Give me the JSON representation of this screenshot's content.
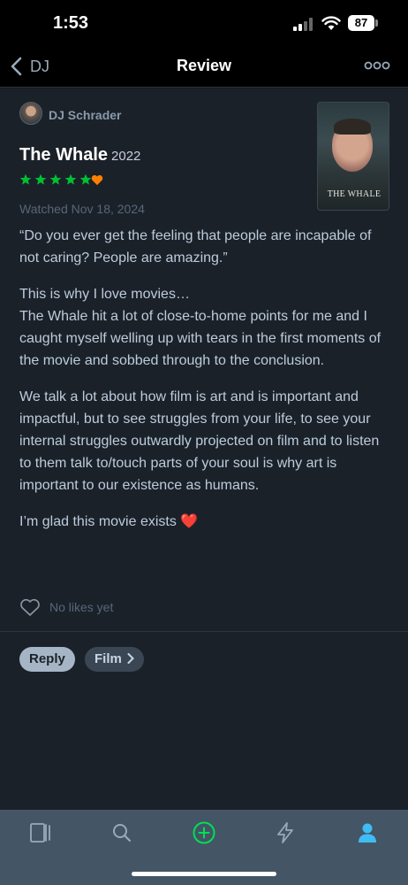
{
  "status_bar": {
    "time": "1:53",
    "battery": "87"
  },
  "nav": {
    "back_label": "DJ",
    "title": "Review"
  },
  "review": {
    "author": "DJ Schrader",
    "film_title": "The Whale",
    "film_year": "2022",
    "rating_stars": 5,
    "liked": true,
    "watched_text": "Watched Nov 18, 2024",
    "poster_text": "THE WHALE",
    "paragraphs": [
      "“Do you ever get the feeling that people are incapable of not caring? People are amazing.”",
      "This is why I love movies…\nThe Whale hit a lot of close-to-home points for me and I caught myself welling up with tears in the first moments of the movie and sobbed through to the conclusion.",
      "We talk a lot about how film is art and is important and impactful, but to see struggles from your life, to see your internal struggles outwardly projected on film and to listen to them talk to/touch parts of your soul is why art is important to our existence as humans.",
      "I’m glad this movie exists ❤️"
    ],
    "likes_text": "No likes yet"
  },
  "actions": {
    "reply_label": "Reply",
    "film_label": "Film"
  },
  "tabs": [
    {
      "name": "tab-films",
      "icon": "films-icon",
      "active": false
    },
    {
      "name": "tab-search",
      "icon": "search-icon",
      "active": false
    },
    {
      "name": "tab-add",
      "icon": "add-icon",
      "active": false
    },
    {
      "name": "tab-activity",
      "icon": "lightning-icon",
      "active": false
    },
    {
      "name": "tab-profile",
      "icon": "profile-icon",
      "active": true
    }
  ],
  "colors": {
    "background": "#14181c",
    "surface": "#1b2129",
    "star_green": "#00c030",
    "heart_orange": "#ff8000",
    "tab_bar": "#445566",
    "active_tab": "#40bcf4",
    "add_green": "#00e054"
  }
}
